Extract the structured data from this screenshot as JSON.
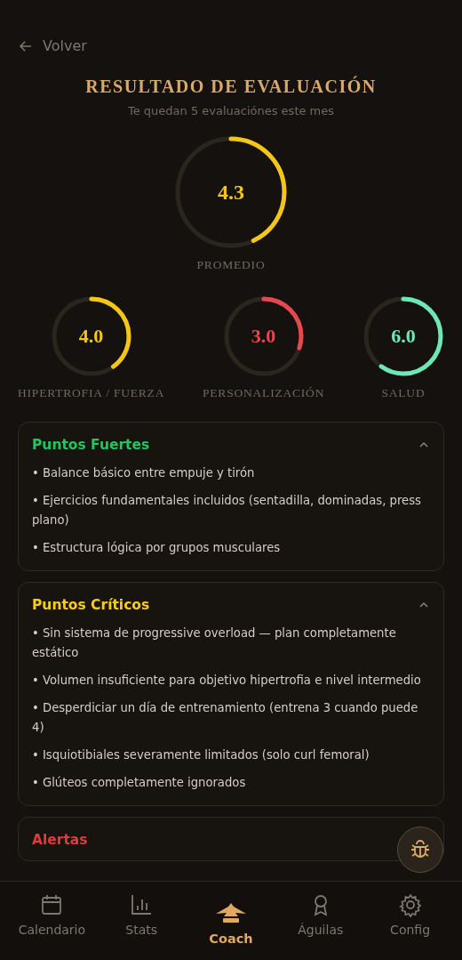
{
  "back": {
    "label": "Volver"
  },
  "header": {
    "title": "RESULTADO DE EVALUACIÓN",
    "subtitle": "Te quedan 5 evaluaciónes este mes"
  },
  "main_score": {
    "value": "4.3",
    "label": "PROMEDIO",
    "color": "#f5c518"
  },
  "scores": [
    {
      "value": "4.0",
      "label": "HIPERTROFIA / FUERZA",
      "color": "#f5c518"
    },
    {
      "value": "3.0",
      "label": "PERSONALIZACIÓN",
      "color": "#e5484d"
    },
    {
      "value": "6.0",
      "label": "SALUD",
      "color": "#6ee7b7"
    }
  ],
  "sections": [
    {
      "title": "Puntos Fuertes",
      "color": "#22c55e",
      "expanded": true,
      "items": [
        "• Balance básico entre empuje y tirón",
        "• Ejercicios fundamentales incluidos (sentadilla, dominadas, press plano)",
        "• Estructura lógica por grupos musculares"
      ]
    },
    {
      "title": "Puntos Críticos",
      "color": "#facc15",
      "expanded": true,
      "items": [
        "• Sin sistema de progressive overload — plan completamente estático",
        "• Volumen insuficiente para objetivo hipertrofia e nivel intermedio",
        "• Desperdiciar un día de entrenamiento (entrena 3 cuando puede 4)",
        "• Isquiotibiales severamente limitados (solo curl femoral)",
        "• Glúteos completamente ignorados"
      ]
    },
    {
      "title": "Alertas",
      "color": "#dc3c3c"
    }
  ],
  "nav": [
    {
      "label": "Calendario",
      "selected": false
    },
    {
      "label": "Stats",
      "selected": false
    },
    {
      "label": "Coach",
      "selected": true
    },
    {
      "label": "Águilas",
      "selected": false
    },
    {
      "label": "Config",
      "selected": false
    }
  ]
}
